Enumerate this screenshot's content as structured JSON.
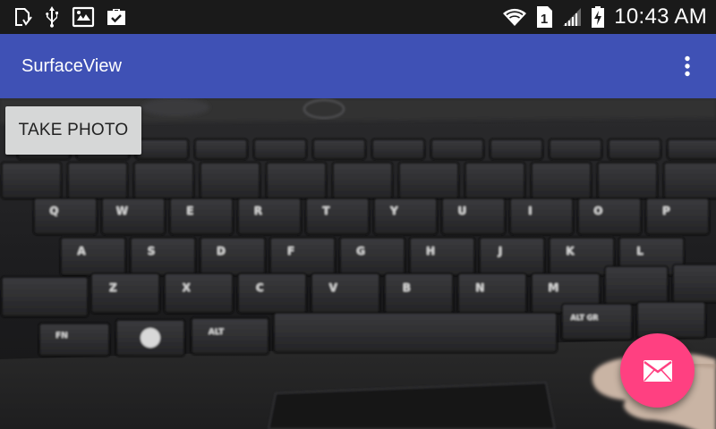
{
  "status_bar": {
    "time": "10:43 AM",
    "sim_slot": "1",
    "icons": [
      "sd-card-icon",
      "usb-icon",
      "image-gallery-icon",
      "briefcase-check-icon",
      "wifi-icon",
      "sim-1-icon",
      "signal-icon",
      "battery-charging-icon"
    ]
  },
  "app_bar": {
    "title": "SurfaceView",
    "menu_icon": "more-vert-icon"
  },
  "main": {
    "take_photo_label": "TAKE PHOTO",
    "fab_icon": "mail-icon"
  },
  "keyboard_labels": {
    "row1": [
      "Q",
      "W",
      "E",
      "R",
      "T",
      "Y",
      "U",
      "I",
      "O",
      "P"
    ],
    "row2": [
      "A",
      "S",
      "D",
      "F",
      "G",
      "H",
      "J",
      "K",
      "L"
    ],
    "row3": [
      "Z",
      "X",
      "C",
      "V",
      "B",
      "N",
      "M"
    ],
    "alt": "ALT",
    "fn": "FN",
    "alt_gr": "ALT GR"
  },
  "colors": {
    "status_bar": "#1a1a1a",
    "app_bar": "#3f51b5",
    "fab": "#ff4081",
    "button": "#d6d7d7"
  }
}
